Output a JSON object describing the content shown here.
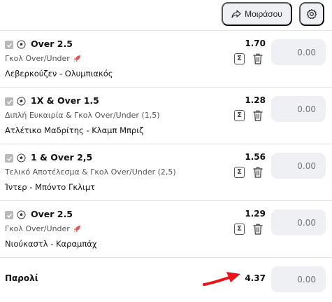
{
  "header": {
    "share_label": "Μοιράσου",
    "share_icon": "share-arrow-icon",
    "settings_icon": "gear-icon"
  },
  "bets": [
    {
      "title": "Over 2.5",
      "market": "Γκολ Over/Under",
      "has_rocket": true,
      "teams": "Λεβερκούζεν - Ολυμπιακός",
      "odds": "1.70",
      "stake_placeholder": "0.00"
    },
    {
      "title": "1X & Over 1.5",
      "market": "Διπλή Ευκαιρία & Γκολ Over/Under (1,5)",
      "has_rocket": false,
      "teams": "Ατλέτικο Μαδρίτης - Κλαμπ Μπριζ",
      "odds": "1.28",
      "stake_placeholder": "0.00"
    },
    {
      "title": "1 & Over 2,5",
      "market": "Τελικό Αποτέλεσμα & Γκολ Over/Under (2,5)",
      "has_rocket": false,
      "teams": "Ίντερ - Μπόντο Γκλιμτ",
      "odds": "1.56",
      "stake_placeholder": "0.00"
    },
    {
      "title": "Over 2.5",
      "market": "Γκολ Over/Under",
      "has_rocket": true,
      "teams": "Νιούκαστλ - Καραμπάχ",
      "odds": "1.29",
      "stake_placeholder": "0.00"
    }
  ],
  "parlay": {
    "label": "Παρολί",
    "total_odds": "4.37",
    "stake_placeholder": "0.00"
  },
  "colors": {
    "annotation_arrow": "#e8131b",
    "input_bg": "#eef0f3",
    "divider": "#e3e3e3"
  }
}
